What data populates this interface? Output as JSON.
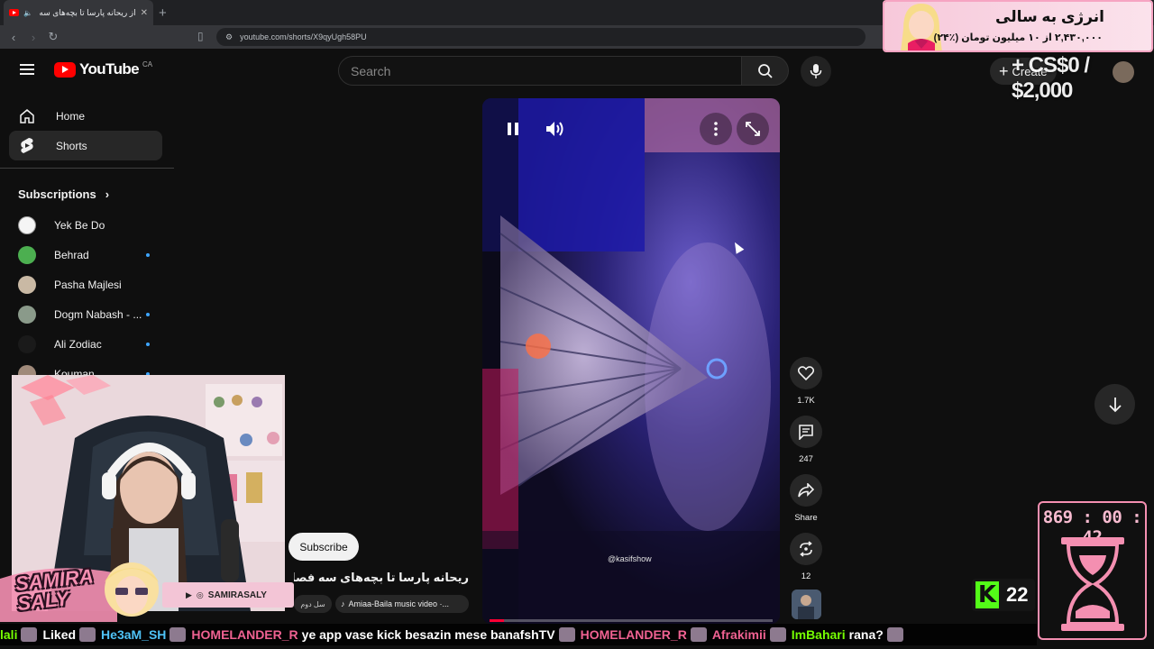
{
  "browser": {
    "tab_title": "از ریحانه پارسا تا بچه‌های سه ف...",
    "new_tab": "+",
    "url": "youtube.com/shorts/X9qyUgh58PU"
  },
  "header": {
    "logo_text": "YouTube",
    "country_code": "CA",
    "search_placeholder": "Search",
    "create_label": "Create",
    "overlay_goal_text": "+ CS$0 / $2,000"
  },
  "sidebar": {
    "nav": [
      {
        "label": "Home",
        "icon": "home-icon"
      },
      {
        "label": "Shorts",
        "icon": "shorts-icon"
      }
    ],
    "subscriptions_title": "Subscriptions",
    "subscriptions": [
      {
        "name": "Yek Be Do",
        "color": "#f5f5f5",
        "new": false
      },
      {
        "name": "Behrad",
        "color": "#4caf50",
        "new": true
      },
      {
        "name": "Pasha Majlesi",
        "color": "#c9b9a4",
        "new": false
      },
      {
        "name": "Dogm Nabash - ...",
        "color": "#8a9a8a",
        "new": true
      },
      {
        "name": "Ali Zodiac",
        "color": "#1a1a1a",
        "new": true
      },
      {
        "name": "Kouman",
        "color": "#a08a7a",
        "new": true
      }
    ]
  },
  "player": {
    "handle": "@kasifshow",
    "progress_fraction": 0.05
  },
  "actions": {
    "likes": "1.7K",
    "comments": "247",
    "share_label": "Share",
    "remix": "12"
  },
  "short_meta": {
    "subscribe_label": "Subscribe",
    "title": "ریحانه پارسا تا بچه‌های سه فصل ...",
    "chip_left": "سل دوم",
    "music": "Amiaa-Baila music video ·..."
  },
  "stream_overlay": {
    "brand_name": "SAMIRA SALY",
    "social_handle": "SAMIRASALY",
    "donation_title": "انرژی به سالی",
    "donation_subtitle": "۲,۴۳۰,۰۰۰ از ۱۰ میلیون تومان (٪۲۴)",
    "timer": "869 : 00 : 42",
    "kick_viewers": "22",
    "colors": {
      "accent_pink": "#f48fb1",
      "kick_green": "#53fc18"
    }
  },
  "chat_ticker": [
    {
      "user": "lali",
      "message": "",
      "style": "green"
    },
    {
      "user": "",
      "message": "Liked",
      "style": ""
    },
    {
      "user": "He3aM_SH",
      "message": "",
      "style": "blue"
    },
    {
      "user": "HOMELANDER_R",
      "message": "ye app vase kick besazin mese banafshTV",
      "style": "pink"
    },
    {
      "user": "HOMELANDER_R",
      "message": "",
      "style": "pink"
    },
    {
      "user": "Afrakimii",
      "message": "",
      "style": "pink"
    },
    {
      "user": "ImBahari",
      "message": "rana?",
      "style": "green"
    }
  ]
}
